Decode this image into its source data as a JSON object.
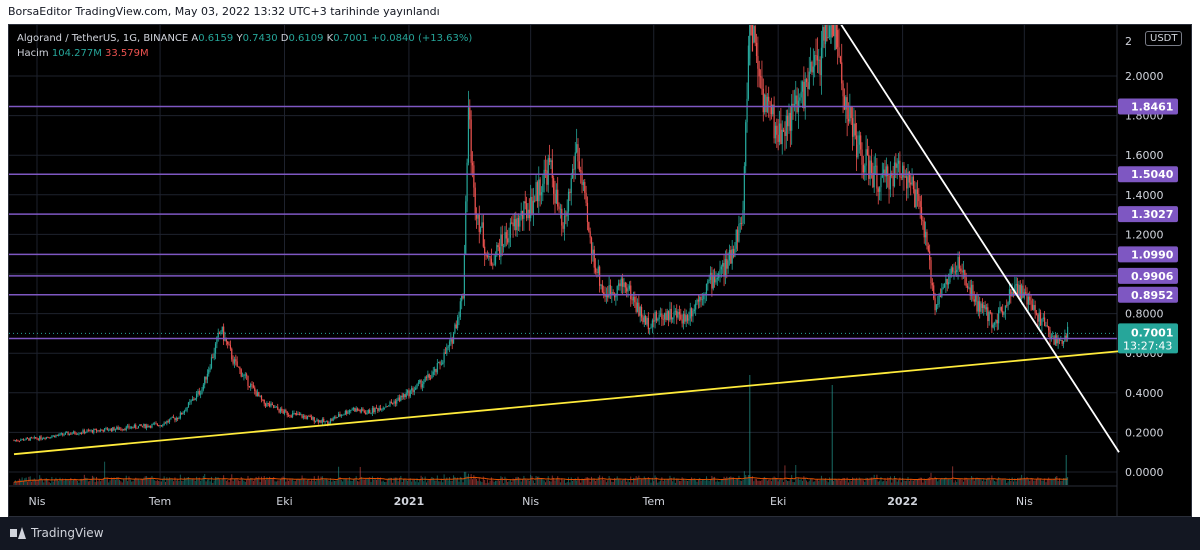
{
  "header": {
    "title": "BorsaEditor TradingView.com, May 03, 2022 13:32 UTC+3 tarihinde yayınlandı"
  },
  "legend": {
    "symbol": "Algorand / TetherUS, 1G, BINANCE",
    "o_label": "A",
    "o_value": "0.6159",
    "h_label": "Y",
    "h_value": "0.7430",
    "l_label": "D",
    "l_value": "0.6109",
    "c_label": "K",
    "c_value": "0.7001",
    "change": "+0.0840 (+13.63%)",
    "volume_label": "Hacim",
    "volume_value1": "104.277M",
    "volume_value2": "33.579M"
  },
  "currency_badge": "USDT",
  "footer": {
    "brand": "TradingView"
  },
  "colors": {
    "up": "#26a69a",
    "down": "#ef5350",
    "level": "#7e57c2",
    "trend": "#ffeb3b",
    "downtrend": "#ffffff",
    "grid": "#1e222d",
    "axis_text": "#d1d4dc",
    "volume_ma": "#e65100"
  },
  "chart_data": {
    "type": "candlestick",
    "symbol": "Algorand / TetherUS",
    "interval": "1G",
    "exchange": "BINANCE",
    "x_ticks": [
      "Nis",
      "Tem",
      "Eki",
      "2021",
      "Nis",
      "Tem",
      "Eki",
      "2022",
      "Nis"
    ],
    "x_tick_dates": [
      "2020-04-01",
      "2020-07-01",
      "2020-10-01",
      "2021-01-01",
      "2021-04-01",
      "2021-07-01",
      "2021-10-01",
      "2022-01-01",
      "2022-04-01"
    ],
    "y_ticks": [
      "0.0000",
      "0.2000",
      "0.4000",
      "0.6000",
      "0.8000",
      "1.0000",
      "1.2000",
      "1.4000",
      "1.6000",
      "1.8000",
      "2.0000",
      "2"
    ],
    "horizontal_levels": [
      {
        "label": "1.8461",
        "value": 1.8461
      },
      {
        "label": "1.5040",
        "value": 1.504
      },
      {
        "label": "1.3027",
        "value": 1.3027
      },
      {
        "label": "1.0990",
        "value": 1.099
      },
      {
        "label": "0.9906",
        "value": 0.9906
      },
      {
        "label": "0.8952",
        "value": 0.8952
      },
      {
        "label": "0.6742",
        "value": 0.6742
      }
    ],
    "last_price": {
      "label": "0.7001",
      "value": 0.7001,
      "countdown": "13:27:43"
    },
    "price_path": [
      [
        "2020-03-15",
        0.16
      ],
      [
        "2020-04-01",
        0.17
      ],
      [
        "2020-05-01",
        0.2
      ],
      [
        "2020-06-01",
        0.22
      ],
      [
        "2020-07-01",
        0.24
      ],
      [
        "2020-07-15",
        0.28
      ],
      [
        "2020-08-01",
        0.42
      ],
      [
        "2020-08-15",
        0.72
      ],
      [
        "2020-08-25",
        0.55
      ],
      [
        "2020-09-15",
        0.35
      ],
      [
        "2020-10-01",
        0.3
      ],
      [
        "2020-10-15",
        0.28
      ],
      [
        "2020-11-01",
        0.25
      ],
      [
        "2020-11-20",
        0.32
      ],
      [
        "2020-12-01",
        0.3
      ],
      [
        "2020-12-20",
        0.35
      ],
      [
        "2021-01-01",
        0.4
      ],
      [
        "2021-01-20",
        0.5
      ],
      [
        "2021-02-01",
        0.65
      ],
      [
        "2021-02-10",
        0.9
      ],
      [
        "2021-02-14",
        1.84
      ],
      [
        "2021-02-18",
        1.4
      ],
      [
        "2021-03-01",
        1.05
      ],
      [
        "2021-03-15",
        1.2
      ],
      [
        "2021-04-01",
        1.35
      ],
      [
        "2021-04-15",
        1.55
      ],
      [
        "2021-04-25",
        1.2
      ],
      [
        "2021-05-05",
        1.65
      ],
      [
        "2021-05-15",
        1.15
      ],
      [
        "2021-05-25",
        0.9
      ],
      [
        "2021-06-10",
        0.95
      ],
      [
        "2021-06-25",
        0.75
      ],
      [
        "2021-07-10",
        0.8
      ],
      [
        "2021-07-25",
        0.78
      ],
      [
        "2021-08-10",
        0.95
      ],
      [
        "2021-08-25",
        1.05
      ],
      [
        "2021-09-05",
        1.3
      ],
      [
        "2021-09-10",
        2.35
      ],
      [
        "2021-09-20",
        1.9
      ],
      [
        "2021-10-01",
        1.7
      ],
      [
        "2021-10-15",
        1.85
      ],
      [
        "2021-11-01",
        2.1
      ],
      [
        "2021-11-10",
        2.35
      ],
      [
        "2021-11-20",
        1.85
      ],
      [
        "2021-12-01",
        1.6
      ],
      [
        "2021-12-15",
        1.45
      ],
      [
        "2022-01-01",
        1.55
      ],
      [
        "2022-01-15",
        1.3
      ],
      [
        "2022-01-25",
        0.85
      ],
      [
        "2022-02-10",
        1.05
      ],
      [
        "2022-02-25",
        0.85
      ],
      [
        "2022-03-10",
        0.75
      ],
      [
        "2022-03-25",
        0.95
      ],
      [
        "2022-04-10",
        0.8
      ],
      [
        "2022-04-25",
        0.65
      ],
      [
        "2022-05-03",
        0.7
      ]
    ],
    "trendlines": [
      {
        "name": "support",
        "from": [
          "2020-03-15",
          0.09
        ],
        "to": [
          "2022-06-10",
          0.61
        ]
      },
      {
        "name": "resistance",
        "from": [
          "2021-11-08",
          2.35
        ],
        "to": [
          "2022-06-10",
          0.1
        ]
      }
    ]
  }
}
